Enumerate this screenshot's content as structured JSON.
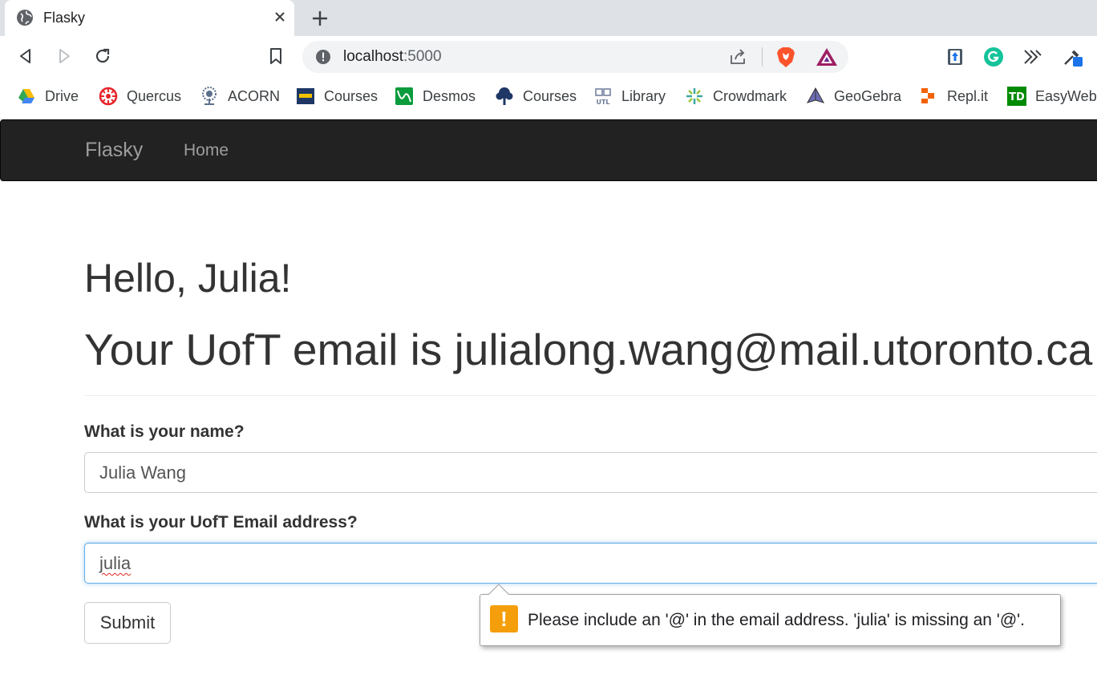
{
  "browser": {
    "tab_title": "Flasky",
    "url_host": "localhost",
    "url_port": ":5000",
    "bookmarks": [
      {
        "label": "Drive",
        "icon": "google-drive-icon"
      },
      {
        "label": "Quercus",
        "icon": "quercus-icon"
      },
      {
        "label": "ACORN",
        "icon": "acorn-icon"
      },
      {
        "label": "Courses",
        "icon": "courses-icon"
      },
      {
        "label": "Desmos",
        "icon": "desmos-icon"
      },
      {
        "label": "Courses",
        "icon": "tree-icon"
      },
      {
        "label": "Library",
        "icon": "library-icon"
      },
      {
        "label": "Crowdmark",
        "icon": "crowdmark-icon"
      },
      {
        "label": "GeoGebra",
        "icon": "geogebra-icon"
      },
      {
        "label": "Repl.it",
        "icon": "replit-icon"
      },
      {
        "label": "EasyWeb",
        "icon": "td-icon"
      }
    ]
  },
  "navbar": {
    "brand": "Flasky",
    "home": "Home"
  },
  "page": {
    "greeting": "Hello, Julia!",
    "email_line": "Your UofT email is julialong.wang@mail.utoronto.ca"
  },
  "form": {
    "name_label": "What is your name?",
    "name_value": "Julia Wang",
    "email_label": "What is your UofT Email address?",
    "email_value": "julia",
    "submit_label": "Submit"
  },
  "validation": {
    "icon": "!",
    "message": "Please include an '@' in the email address. 'julia' is missing an '@'."
  }
}
